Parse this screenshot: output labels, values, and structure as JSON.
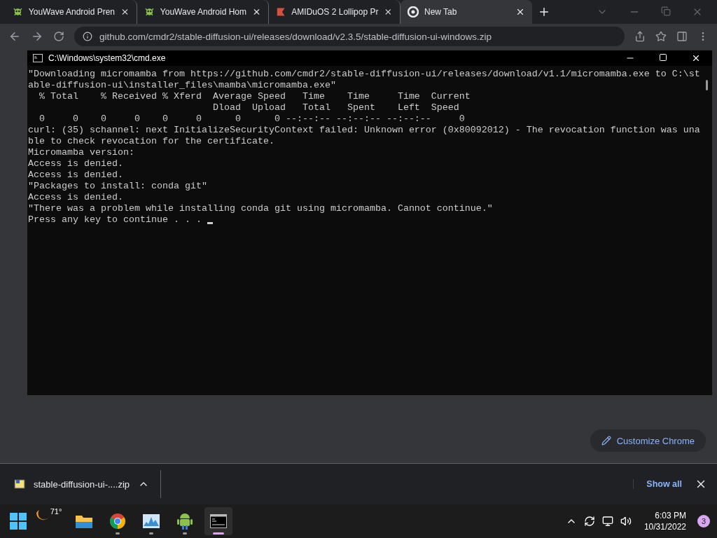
{
  "browser": {
    "tabs": [
      {
        "title": "YouWave Android Pren",
        "kind": "bug",
        "selected": false
      },
      {
        "title": "YouWave Android Hom",
        "kind": "bug",
        "selected": false
      },
      {
        "title": "AMIDuOS 2 Lollipop Pr",
        "kind": "flag",
        "selected": false
      },
      {
        "title": "New Tab",
        "kind": "chrome",
        "selected": true
      }
    ],
    "address_bar": {
      "url": "github.com/cmdr2/stable-diffusion-ui/releases/download/v2.3.5/stable-diffusion-ui-windows.zip"
    },
    "customize_button": "Customize Chrome",
    "download_bar": {
      "file": "stable-diffusion-ui-....zip",
      "show_all": "Show all"
    }
  },
  "console_window": {
    "title": "C:\\Windows\\system32\\cmd.exe",
    "lines": [
      "\"Downloading micromamba from https://github.com/cmdr2/stable-diffusion-ui/releases/download/v1.1/micromamba.exe to C:\\st",
      "able-diffusion-ui\\installer_files\\mamba\\micromamba.exe\"",
      "  % Total    % Received % Xferd  Average Speed   Time    Time     Time  Current",
      "                                 Dload  Upload   Total   Spent    Left  Speed",
      "  0     0    0     0    0     0      0      0 --:--:-- --:--:-- --:--:--     0",
      "curl: (35) schannel: next InitializeSecurityContext failed: Unknown error (0x80092012) - The revocation function was una",
      "ble to check revocation for the certificate.",
      "Micromamba version:",
      "Access is denied.",
      "Access is denied.",
      "\"Packages to install: conda git\"",
      "Access is denied.",
      "\"There was a problem while installing conda git using micromamba. Cannot continue.\"",
      "Press any key to continue . . . "
    ]
  },
  "taskbar": {
    "weather": "71°",
    "apps": [
      {
        "kind": "explorer",
        "running": false,
        "active": false
      },
      {
        "kind": "chrome",
        "running": true,
        "active": false
      },
      {
        "kind": "monitor",
        "running": true,
        "active": false
      },
      {
        "kind": "android",
        "running": true,
        "active": false
      },
      {
        "kind": "console",
        "running": true,
        "active": true
      }
    ],
    "clock": {
      "time": "6:03 PM",
      "date": "10/31/2022"
    },
    "notification_count": "3"
  }
}
